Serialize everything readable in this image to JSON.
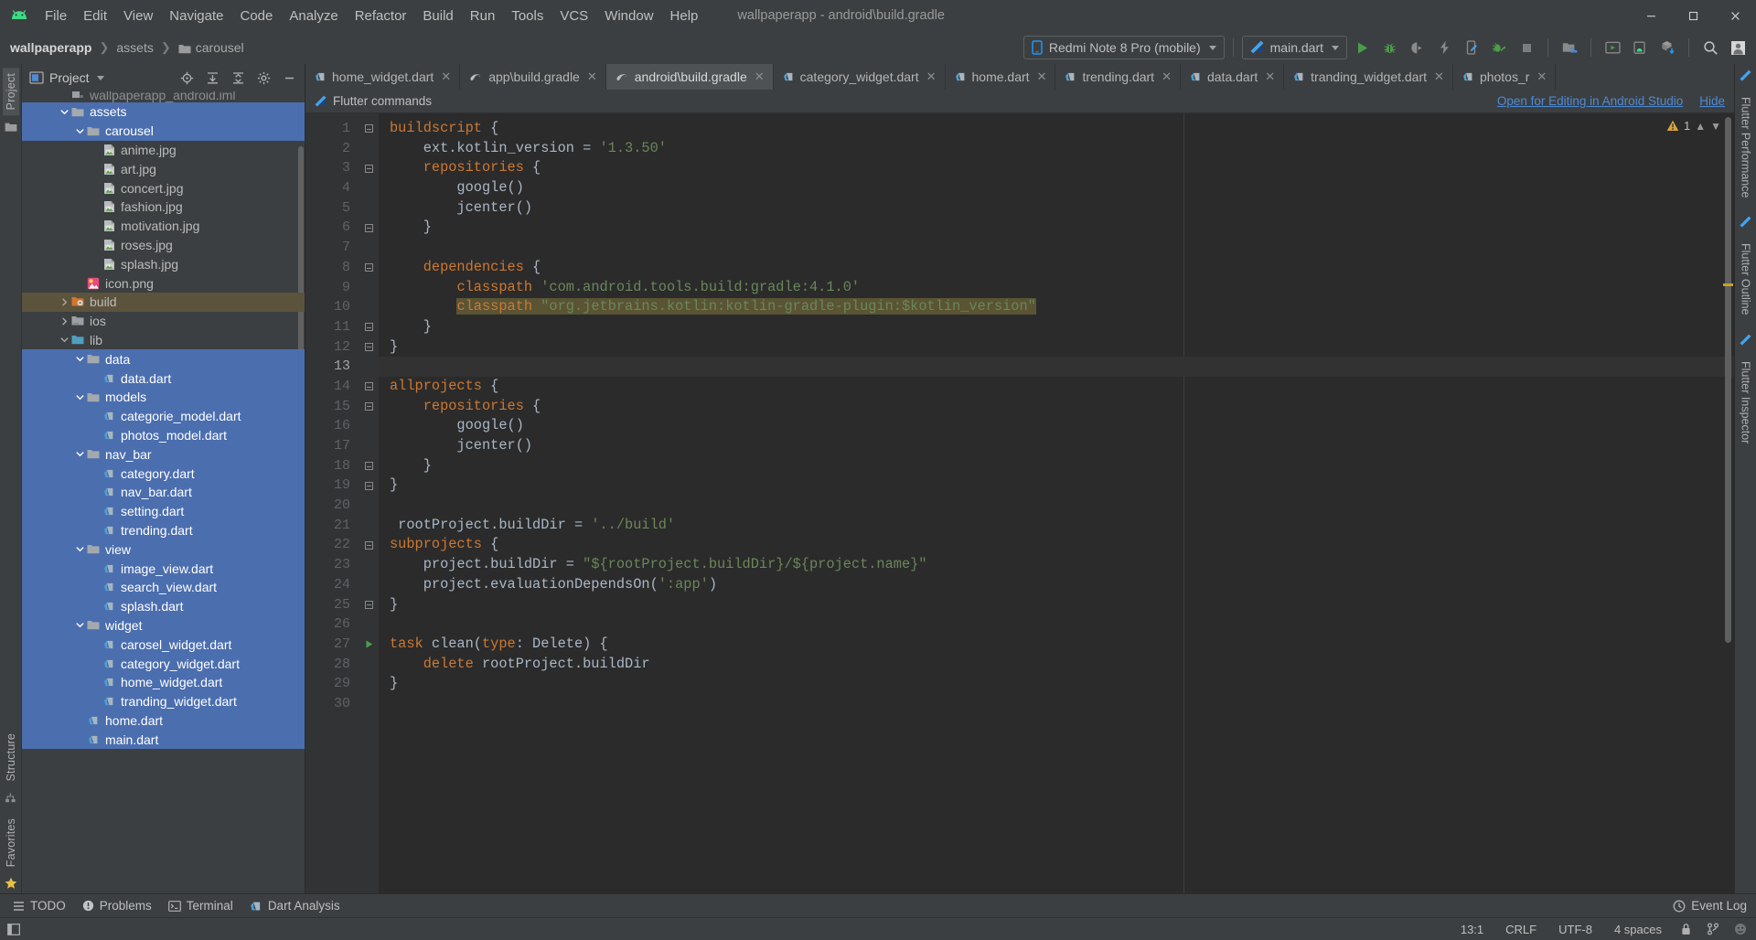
{
  "window": {
    "title": "wallpaperapp - android\\build.gradle",
    "controls": {
      "minimize": "minimize-icon",
      "maximize": "maximize-icon",
      "close": "close-icon"
    }
  },
  "menubar": {
    "logo": "android-studio-icon",
    "items": [
      {
        "label": "File",
        "mnemonic": "F"
      },
      {
        "label": "Edit",
        "mnemonic": "E"
      },
      {
        "label": "View",
        "mnemonic": "V"
      },
      {
        "label": "Navigate",
        "mnemonic": "N"
      },
      {
        "label": "Code",
        "mnemonic": "C"
      },
      {
        "label": "Analyze",
        "mnemonic": "z"
      },
      {
        "label": "Refactor",
        "mnemonic": "R"
      },
      {
        "label": "Build",
        "mnemonic": "B"
      },
      {
        "label": "Run",
        "mnemonic": "u"
      },
      {
        "label": "Tools",
        "mnemonic": "T"
      },
      {
        "label": "VCS",
        "mnemonic": ""
      },
      {
        "label": "Window",
        "mnemonic": "W"
      },
      {
        "label": "Help",
        "mnemonic": "H"
      }
    ]
  },
  "breadcrumb": {
    "items": [
      "wallpaperapp",
      "assets",
      "carousel"
    ]
  },
  "toolbar": {
    "device_selector": {
      "label": "Redmi Note 8 Pro (mobile)",
      "icon": "phone-icon"
    },
    "run_config": {
      "label": "main.dart",
      "icon": "flutter-icon"
    },
    "buttons": [
      {
        "name": "run-button",
        "icon": "play-icon",
        "color": "#4a9e4a"
      },
      {
        "name": "debug-button",
        "icon": "bug-icon",
        "color": "#4a9e4a"
      },
      {
        "name": "run-coverage-button",
        "icon": "coverage-icon",
        "color": "#888888"
      },
      {
        "name": "hot-reload-button",
        "icon": "lightning-icon",
        "color": "#888888"
      },
      {
        "name": "flutter-attach-button",
        "icon": "device-flutter-icon",
        "color": "#888888"
      },
      {
        "name": "profile-button",
        "icon": "bug-arrow-icon",
        "color": "#4a9e4a"
      },
      {
        "name": "stop-button",
        "icon": "stop-icon",
        "color": "#888888"
      },
      {
        "name": "project-structure-button",
        "icon": "project-structure-icon",
        "color": "#888888"
      },
      {
        "name": "avd-manager-button",
        "icon": "avd-manager-icon",
        "color": "#888888"
      },
      {
        "name": "sdk-manager-button",
        "icon": "sdk-manager-icon",
        "color": "#888888"
      },
      {
        "name": "gradle-sync-button",
        "icon": "gradle-sync-icon",
        "color": "#4f8ad4"
      },
      {
        "name": "search-everywhere-button",
        "icon": "search-icon",
        "color": "#bbbbbb"
      },
      {
        "name": "user-account-button",
        "icon": "avatar-icon",
        "color": "#dddddd"
      }
    ]
  },
  "left_strip": {
    "top": [
      {
        "label": "Project",
        "active": true
      }
    ],
    "bottom": [
      {
        "label": "Structure"
      },
      {
        "label": "Favorites"
      }
    ]
  },
  "right_strip": {
    "tabs": [
      "Flutter Performance",
      "Flutter Outline",
      "Flutter Inspector"
    ]
  },
  "project_panel": {
    "title": "Project",
    "header_icons": [
      "locate-icon",
      "expand-all-icon",
      "collapse-all-icon",
      "settings-icon",
      "hide-icon"
    ],
    "tree": [
      {
        "label": "wallpaperapp_android.iml",
        "depth": 2,
        "icon": "iml-icon",
        "state": "clipped",
        "selected": false,
        "arrow": "none"
      },
      {
        "label": "assets",
        "depth": 2,
        "icon": "folder-icon",
        "selected": true,
        "arrow": "down"
      },
      {
        "label": "carousel",
        "depth": 3,
        "icon": "folder-icon",
        "selected": true,
        "arrow": "down"
      },
      {
        "label": "anime.jpg",
        "depth": 4,
        "icon": "image-icon",
        "selected": false,
        "arrow": "none"
      },
      {
        "label": "art.jpg",
        "depth": 4,
        "icon": "image-icon",
        "selected": false,
        "arrow": "none"
      },
      {
        "label": "concert.jpg",
        "depth": 4,
        "icon": "image-icon",
        "selected": false,
        "arrow": "none"
      },
      {
        "label": "fashion.jpg",
        "depth": 4,
        "icon": "image-icon",
        "selected": false,
        "arrow": "none"
      },
      {
        "label": "motivation.jpg",
        "depth": 4,
        "icon": "image-icon",
        "selected": false,
        "arrow": "none"
      },
      {
        "label": "roses.jpg",
        "depth": 4,
        "icon": "image-icon",
        "selected": false,
        "arrow": "none"
      },
      {
        "label": "splash.jpg",
        "depth": 4,
        "icon": "image-icon",
        "selected": false,
        "arrow": "none"
      },
      {
        "label": "icon.png",
        "depth": 3,
        "icon": "png-icon",
        "selected": false,
        "arrow": "none"
      },
      {
        "label": "build",
        "depth": 2,
        "icon": "build-folder-icon",
        "selected": false,
        "highlight": "build",
        "arrow": "right"
      },
      {
        "label": "ios",
        "depth": 2,
        "icon": "ios-folder-icon",
        "selected": false,
        "arrow": "right"
      },
      {
        "label": "lib",
        "depth": 2,
        "icon": "lib-folder-icon",
        "selected": false,
        "arrow": "down"
      },
      {
        "label": "data",
        "depth": 3,
        "icon": "folder-icon",
        "selected": true,
        "arrow": "down"
      },
      {
        "label": "data.dart",
        "depth": 4,
        "icon": "dart-icon",
        "selected": true,
        "arrow": "none"
      },
      {
        "label": "models",
        "depth": 3,
        "icon": "folder-icon",
        "selected": true,
        "arrow": "down"
      },
      {
        "label": "categorie_model.dart",
        "depth": 4,
        "icon": "dart-icon",
        "selected": true,
        "arrow": "none"
      },
      {
        "label": "photos_model.dart",
        "depth": 4,
        "icon": "dart-icon",
        "selected": true,
        "arrow": "none"
      },
      {
        "label": "nav_bar",
        "depth": 3,
        "icon": "folder-icon",
        "selected": true,
        "arrow": "down"
      },
      {
        "label": "category.dart",
        "depth": 4,
        "icon": "dart-icon",
        "selected": true,
        "arrow": "none"
      },
      {
        "label": "nav_bar.dart",
        "depth": 4,
        "icon": "dart-icon",
        "selected": true,
        "arrow": "none"
      },
      {
        "label": "setting.dart",
        "depth": 4,
        "icon": "dart-icon",
        "selected": true,
        "arrow": "none"
      },
      {
        "label": "trending.dart",
        "depth": 4,
        "icon": "dart-icon",
        "selected": true,
        "arrow": "none"
      },
      {
        "label": "view",
        "depth": 3,
        "icon": "folder-icon",
        "selected": true,
        "arrow": "down"
      },
      {
        "label": "image_view.dart",
        "depth": 4,
        "icon": "dart-icon",
        "selected": true,
        "arrow": "none"
      },
      {
        "label": "search_view.dart",
        "depth": 4,
        "icon": "dart-icon",
        "selected": true,
        "arrow": "none"
      },
      {
        "label": "splash.dart",
        "depth": 4,
        "icon": "dart-icon",
        "selected": true,
        "arrow": "none"
      },
      {
        "label": "widget",
        "depth": 3,
        "icon": "folder-icon",
        "selected": true,
        "arrow": "down"
      },
      {
        "label": "carosel_widget.dart",
        "depth": 4,
        "icon": "dart-icon",
        "selected": true,
        "arrow": "none"
      },
      {
        "label": "category_widget.dart",
        "depth": 4,
        "icon": "dart-icon",
        "selected": true,
        "arrow": "none"
      },
      {
        "label": "home_widget.dart",
        "depth": 4,
        "icon": "dart-icon",
        "selected": true,
        "arrow": "none"
      },
      {
        "label": "tranding_widget.dart",
        "depth": 4,
        "icon": "dart-icon",
        "selected": true,
        "arrow": "none"
      },
      {
        "label": "home.dart",
        "depth": 3,
        "icon": "dart-icon",
        "selected": true,
        "arrow": "none"
      },
      {
        "label": "main.dart",
        "depth": 3,
        "icon": "dart-icon",
        "selected": true,
        "arrow": "none"
      }
    ]
  },
  "editor": {
    "tabs": [
      {
        "label": "home_widget.dart",
        "icon": "dart-icon",
        "active": false
      },
      {
        "label": "app\\build.gradle",
        "icon": "gradle-icon",
        "active": false
      },
      {
        "label": "android\\build.gradle",
        "icon": "gradle-icon",
        "active": true
      },
      {
        "label": "category_widget.dart",
        "icon": "dart-icon",
        "active": false
      },
      {
        "label": "home.dart",
        "icon": "dart-icon",
        "active": false
      },
      {
        "label": "trending.dart",
        "icon": "dart-icon",
        "active": false
      },
      {
        "label": "data.dart",
        "icon": "dart-icon",
        "active": false
      },
      {
        "label": "tranding_widget.dart",
        "icon": "dart-icon",
        "active": false
      },
      {
        "label": "photos_r",
        "icon": "dart-icon",
        "active": false
      }
    ],
    "flutter_bar": {
      "label": "Flutter commands",
      "icon": "flutter-icon",
      "open_link": "Open for Editing in Android Studio",
      "hide_link": "Hide"
    },
    "inspection": {
      "warning_count": "1",
      "icon": "warning-icon"
    },
    "lines": [
      {
        "n": 1,
        "text": "buildscript {",
        "fold": "open"
      },
      {
        "n": 2,
        "text": "    ext.kotlin_version = '1.3.50'"
      },
      {
        "n": 3,
        "text": "    repositories {",
        "fold": "open"
      },
      {
        "n": 4,
        "text": "        google()"
      },
      {
        "n": 5,
        "text": "        jcenter()"
      },
      {
        "n": 6,
        "text": "    }",
        "fold": "close"
      },
      {
        "n": 7,
        "text": ""
      },
      {
        "n": 8,
        "text": "    dependencies {",
        "fold": "open"
      },
      {
        "n": 9,
        "text": "        classpath 'com.android.tools.build:gradle:4.1.0'"
      },
      {
        "n": 10,
        "text": "        classpath \"org.jetbrains.kotlin:kotlin-gradle-plugin:$kotlin_version\"",
        "selected": true
      },
      {
        "n": 11,
        "text": "    }",
        "fold": "close"
      },
      {
        "n": 12,
        "text": "}",
        "fold": "close"
      },
      {
        "n": 13,
        "text": "",
        "caret": true
      },
      {
        "n": 14,
        "text": "allprojects {",
        "fold": "open"
      },
      {
        "n": 15,
        "text": "    repositories {",
        "fold": "open"
      },
      {
        "n": 16,
        "text": "        google()"
      },
      {
        "n": 17,
        "text": "        jcenter()"
      },
      {
        "n": 18,
        "text": "    }",
        "fold": "close"
      },
      {
        "n": 19,
        "text": "}",
        "fold": "close"
      },
      {
        "n": 20,
        "text": ""
      },
      {
        "n": 21,
        "text": " rootProject.buildDir = '../build'"
      },
      {
        "n": 22,
        "text": "subprojects {",
        "fold": "open"
      },
      {
        "n": 23,
        "text": "    project.buildDir = \"${rootProject.buildDir}/${project.name}\""
      },
      {
        "n": 24,
        "text": "    project.evaluationDependsOn(':app')"
      },
      {
        "n": 25,
        "text": "}",
        "fold": "close"
      },
      {
        "n": 26,
        "text": ""
      },
      {
        "n": 27,
        "text": "task clean(type: Delete) {",
        "run": true
      },
      {
        "n": 28,
        "text": "    delete rootProject.buildDir"
      },
      {
        "n": 29,
        "text": "}"
      },
      {
        "n": 30,
        "text": ""
      }
    ]
  },
  "bottom_bar": {
    "items": [
      {
        "label": "TODO",
        "icon": "todo-icon"
      },
      {
        "label": "Problems",
        "icon": "problems-icon"
      },
      {
        "label": "Terminal",
        "icon": "terminal-icon"
      },
      {
        "label": "Dart Analysis",
        "icon": "dart-icon"
      }
    ],
    "event_log": {
      "label": "Event Log",
      "icon": "event-log-icon"
    }
  },
  "status_bar": {
    "position": "13:1",
    "line_ending": "CRLF",
    "encoding": "UTF-8",
    "indent": "4 spaces",
    "icons": [
      "lock-icon",
      "branch-icon",
      "inspection-icon"
    ]
  }
}
